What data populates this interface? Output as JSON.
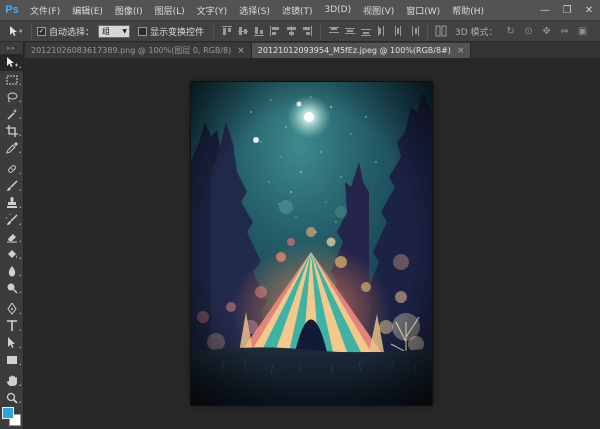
{
  "app": {
    "logo": "Ps"
  },
  "menu": {
    "items": [
      "文件(F)",
      "编辑(E)",
      "图像(I)",
      "图层(L)",
      "文字(Y)",
      "选择(S)",
      "滤镜(T)",
      "3D(D)",
      "视图(V)",
      "窗口(W)",
      "帮助(H)"
    ]
  },
  "window_controls": {
    "minimize": "—",
    "restore": "❐",
    "close": "✕"
  },
  "options": {
    "auto_select_label": "自动选择：",
    "auto_select_value": "组",
    "show_transform_label": "显示变换控件",
    "mode_label": "3D 模式："
  },
  "tabs": [
    {
      "label": "20121026083617389.png @ 100%(图层 0, RGB/8)",
      "close": "×"
    },
    {
      "label": "20121012093954_M5fEz.jpeg @ 100%(RGB/8#)",
      "close": "×"
    }
  ],
  "colors": {
    "foreground": "#2aa6d8",
    "background": "#ffffff",
    "accent": "#3fb0ff"
  },
  "tools": [
    "move-tool-icon",
    "marquee-tool-icon",
    "lasso-tool-icon",
    "magic-wand-tool-icon",
    "crop-tool-icon",
    "eyedropper-tool-icon",
    "healing-brush-tool-icon",
    "brush-tool-icon",
    "clone-stamp-tool-icon",
    "history-brush-tool-icon",
    "eraser-tool-icon",
    "paint-bucket-tool-icon",
    "blur-tool-icon",
    "dodge-tool-icon",
    "pen-tool-icon",
    "type-tool-icon",
    "path-selection-tool-icon",
    "rectangle-tool-icon",
    "hand-tool-icon",
    "zoom-tool-icon"
  ]
}
